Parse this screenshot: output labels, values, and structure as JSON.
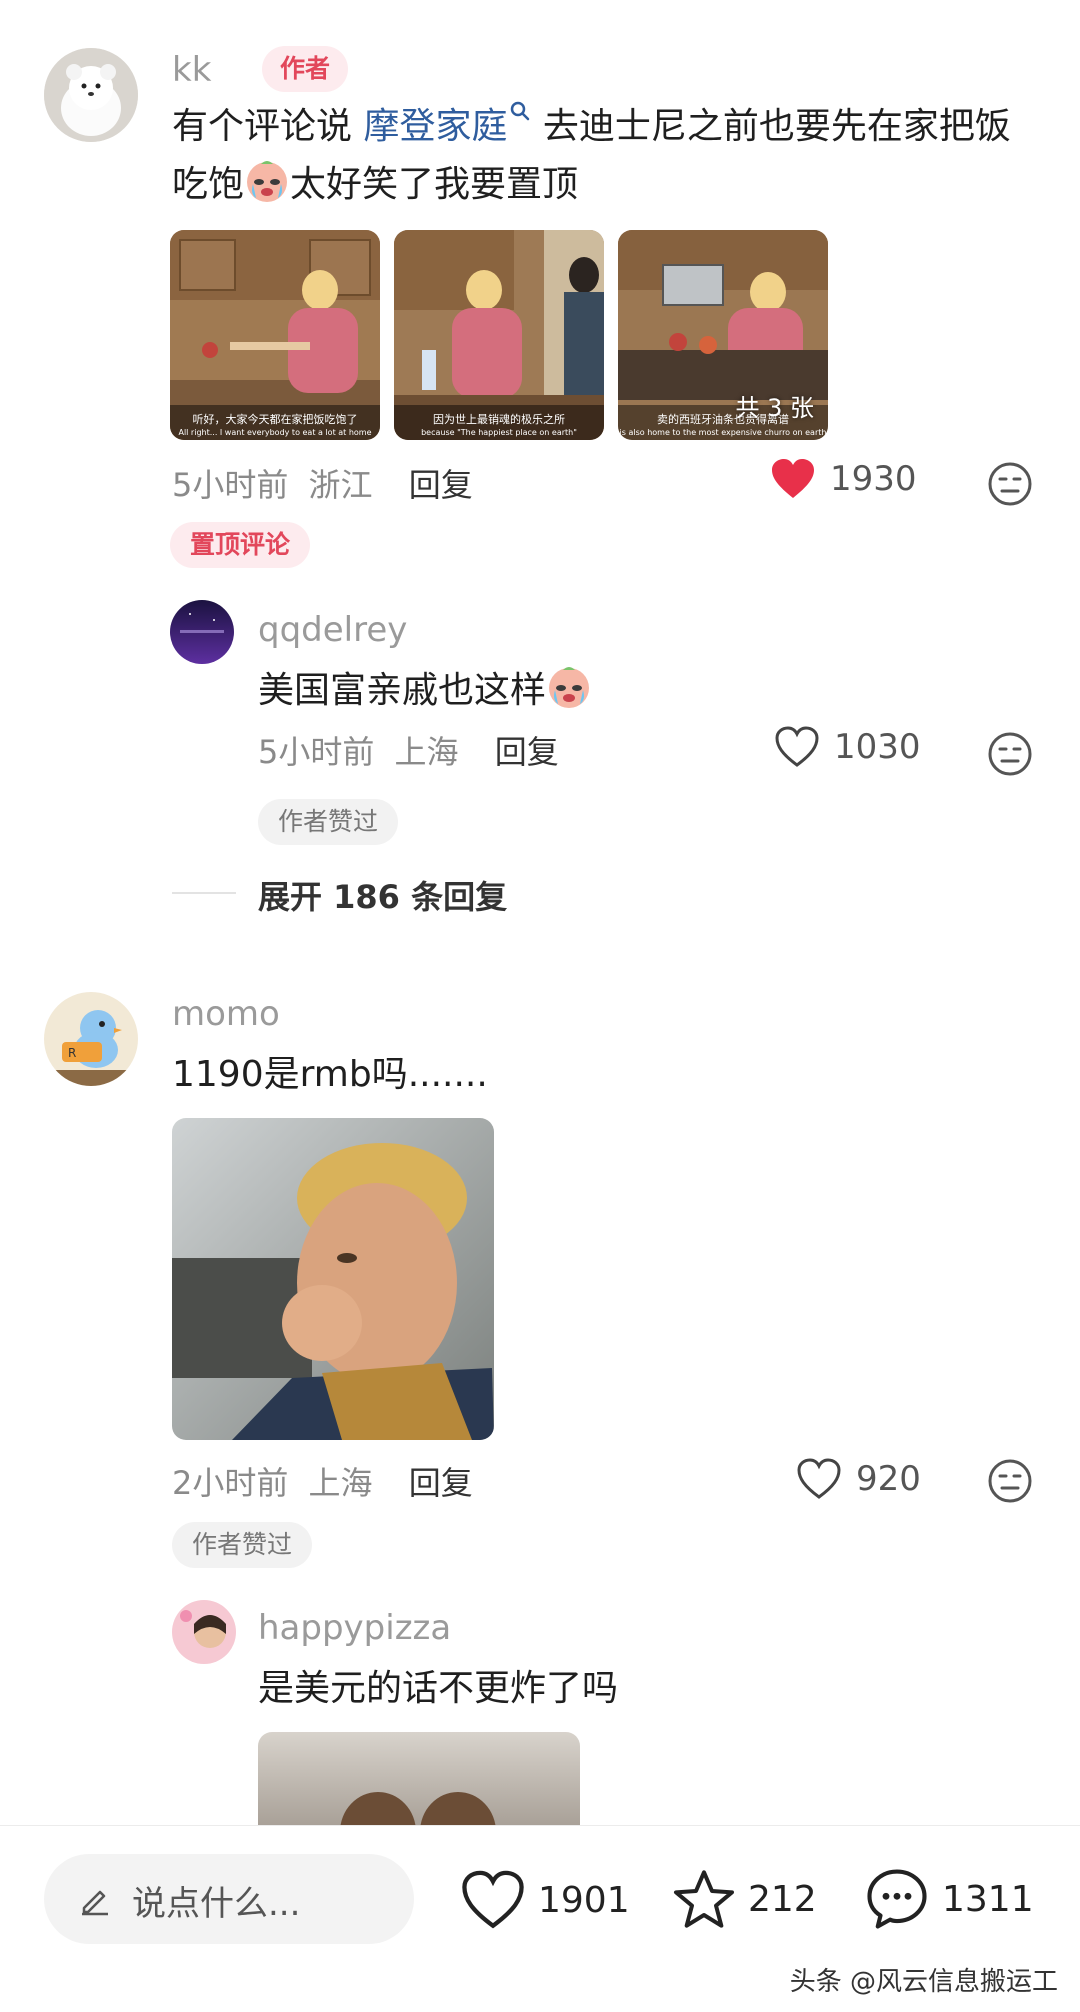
{
  "comments": [
    {
      "username": "kk",
      "author_tag": "作者",
      "text_before": "有个评论说 ",
      "link": "摩登家庭",
      "text_after": " 去迪士尼之前也要先在家把饭吃饱",
      "text_end": "太好笑了我要置顶",
      "images": [
        {
          "caption_cn": "听好，大家今天都在家把饭吃饱了",
          "caption_en": "All right... I want everybody to eat a lot at home"
        },
        {
          "caption_cn": "因为世上最销魂的极乐之所",
          "caption_en": "because \"The happiest place on earth\""
        },
        {
          "caption_cn": "卖的西班牙油条也贵得离谱",
          "caption_en": "is also home to the most expensive churro on earth",
          "overlay": "共 3 张"
        }
      ],
      "time": "5小时前",
      "location": "浙江",
      "reply": "回复",
      "likes": "1930",
      "liked": true,
      "badge": "置顶评论"
    },
    {
      "username": "qqdelrey",
      "text": "美国富亲戚也这样",
      "time": "5小时前",
      "location": "上海",
      "reply": "回复",
      "likes": "1030",
      "badge": "作者赞过"
    },
    {
      "username": "momo",
      "text": "1190是rmb吗.......",
      "time": "2小时前",
      "location": "上海",
      "reply": "回复",
      "likes": "920",
      "badge": "作者赞过"
    },
    {
      "username": "happypizza",
      "text": "是美元的话不更炸了吗"
    }
  ],
  "expand_replies": "展开 186 条回复",
  "bottom_bar": {
    "placeholder": "说点什么...",
    "likes": "1901",
    "stars": "212",
    "comments": "1311"
  },
  "watermark": "头条 @风云信息搬运工",
  "colors": {
    "accent_red": "#e2475b",
    "link_blue": "#2f5d9e",
    "heart_red": "#e8304a"
  }
}
